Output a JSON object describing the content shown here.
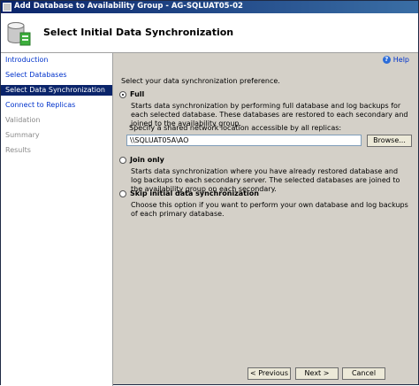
{
  "window": {
    "title": "Add Database to Availability Group - AG-SQLUAT05-02"
  },
  "header": {
    "title": "Select Initial Data Synchronization"
  },
  "sidebar": {
    "items": [
      {
        "label": "Introduction",
        "state": "link"
      },
      {
        "label": "Select Databases",
        "state": "link"
      },
      {
        "label": "Select Data Synchronization",
        "state": "selected"
      },
      {
        "label": "Connect to Replicas",
        "state": "link"
      },
      {
        "label": "Validation",
        "state": "disabled"
      },
      {
        "label": "Summary",
        "state": "disabled"
      },
      {
        "label": "Results",
        "state": "disabled"
      }
    ]
  },
  "main": {
    "help_label": "Help",
    "prompt": "Select your data synchronization preference.",
    "options": {
      "full": {
        "label": "Full",
        "checked": true,
        "description": "Starts data synchronization by performing full database and log backups for each selected database. These databases are restored to each secondary and joined to the availability group."
      },
      "join": {
        "label": "Join only",
        "checked": false,
        "description": "Starts data synchronization where you have already restored database and log backups to each secondary server. The selected databases are joined to the availability group on each secondary."
      },
      "skip": {
        "label": "Skip initial data synchronization",
        "checked": false,
        "description": "Choose this option if you want to perform your own database and log backups of each primary database."
      }
    },
    "share_label": "Specify a shared network location accessible by all replicas:",
    "share_value": "\\\\SQLUAT05A\\AO",
    "browse_label": "Browse..."
  },
  "footer": {
    "previous_label": "< Previous",
    "next_label": "Next >",
    "cancel_label": "Cancel"
  },
  "colors": {
    "titlebar": "#0a246a",
    "selection": "#0a246a",
    "link": "#0033cc",
    "dialog": "#d4d0c8"
  },
  "icons": {
    "app": "window-icon",
    "header": "database-icon",
    "help": "help-icon"
  }
}
